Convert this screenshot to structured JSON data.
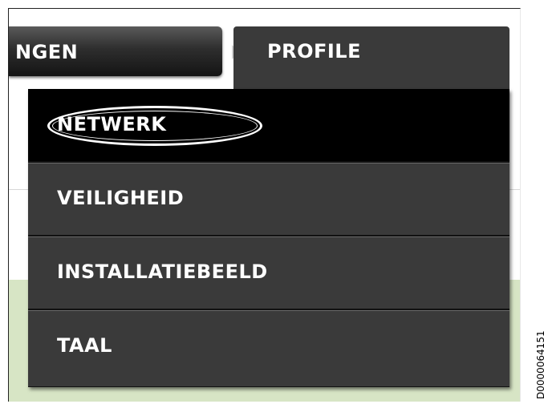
{
  "tabs": {
    "previous_partial_label": "NGEN",
    "active_label": "PROFILE"
  },
  "menu": {
    "items": [
      {
        "label": "NETWERK",
        "highlighted": true
      },
      {
        "label": "VEILIGHEID",
        "highlighted": false
      },
      {
        "label": "INSTALLATIEBEELD",
        "highlighted": false
      },
      {
        "label": "TAAL",
        "highlighted": false
      }
    ]
  },
  "document_id": "D0000064151",
  "colors": {
    "menu_bg": "#3a3a3a",
    "menu_active_bg": "#000000",
    "text": "#ffffff",
    "background_green": "#d7e5c5"
  }
}
